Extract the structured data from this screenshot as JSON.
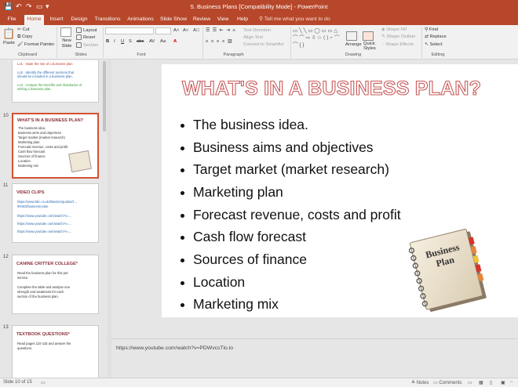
{
  "window": {
    "title": "5. Business Plans [Compatibility Mode] - PowerPoint"
  },
  "ribbon_tabs": [
    "File",
    "Home",
    "Insert",
    "Design",
    "Transitions",
    "Animations",
    "Slide Show",
    "Review",
    "View",
    "Help"
  ],
  "tell_me": "Tell me what you want to do",
  "clipboard": {
    "paste": "Paste",
    "cut": "Cut",
    "copy": "Copy",
    "format_painter": "Format Painter",
    "label": "Clipboard"
  },
  "slides_group": {
    "new_slide": "New Slide",
    "layout": "Layout",
    "reset": "Reset",
    "section": "Section",
    "label": "Slides"
  },
  "font_group": {
    "label": "Font"
  },
  "paragraph_group": {
    "text_direction": "Text Direction",
    "align_text": "Align Text",
    "smartart": "Convert to SmartArt",
    "label": "Paragraph"
  },
  "drawing_group": {
    "arrange": "Arrange",
    "quick_styles": "Quick Styles",
    "shape_fill": "Shape Fill",
    "shape_outline": "Shape Outline",
    "shape_effects": "Shape Effects",
    "label": "Drawing"
  },
  "editing_group": {
    "find": "Find",
    "replace": "Replace",
    "select": "Select",
    "label": "Editing"
  },
  "thumbnails": {
    "t9": {
      "lines": [
        "Lo1 - State the role of a business plan",
        "Lo2 - Identify the different sections that",
        "should be included in a business plan.",
        "Lo3 - Analyse the benefits and drawbacks of",
        "writing a business plan."
      ]
    },
    "t10": {
      "num": "10",
      "title": "WHAT'S IN A BUSINESS PLAN?",
      "lines": [
        "The business idea.",
        "Business aims and objectives",
        "Target market (market research)",
        "Marketing plan",
        "Forecast revenue, costs and profit",
        "Cash flow forecast",
        "Sources of finance",
        "Location",
        "Marketing mix"
      ]
    },
    "t11": {
      "num": "11",
      "title": "VIDEO CLIPS",
      "lines": [
        "https://www.bbc.co.uk/bitesize/guides/z...",
        "9RSDt/business-plan",
        "https://www.youtube.com/watch?v=...",
        "https://www.youtube.com/watch?v=...",
        "https://www.youtube.com/watch?v=..."
      ]
    },
    "t12": {
      "num": "12",
      "title": "CANINE CRITTER COLLEGE*",
      "lines": [
        "Read the business plan for this pet",
        "service.",
        "Complete the table and analyse one",
        "strength and weakness for each",
        "section of the business plan."
      ]
    },
    "t13": {
      "num": "13",
      "title": "TEXTBOOK QUESTIONS*",
      "lines": [
        "Read pages 110-115 and answer the",
        "questions."
      ]
    }
  },
  "slide": {
    "title": "WHAT'S IN A BUSINESS PLAN?",
    "bullets": [
      "The business idea.",
      "Business aims and objectives",
      "Target market (market research)",
      "Marketing plan",
      "Forecast revenue, costs and profit",
      "Cash flow forecast",
      "Sources of finance",
      "Location",
      "Marketing mix"
    ],
    "book_text_1": "Business",
    "book_text_2": "Plan"
  },
  "notes": "https://www.youtube.com/watch?v=PDWvcsTlo.lo",
  "status": {
    "slide": "Slide 10 of 15",
    "notes": "Notes",
    "comments": "Comments"
  },
  "colors": {
    "accent": "#b7472a",
    "title": "#c85a5a"
  }
}
